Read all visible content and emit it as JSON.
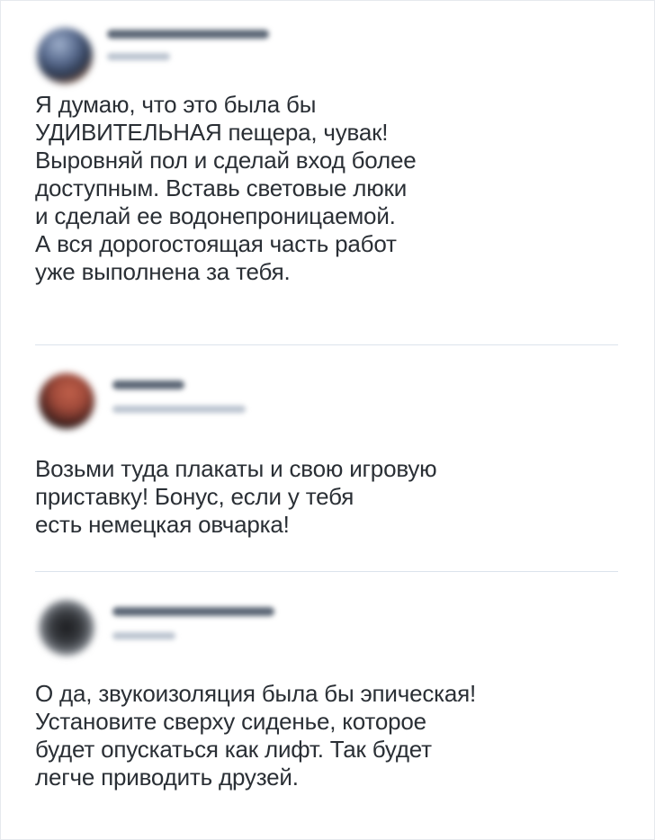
{
  "comments": [
    {
      "author": "",
      "time": "",
      "text": "Я думаю, что это была бы\nУДИВИТЕЛЬНАЯ пещера, чувак!\nВыровняй пол и сделай вход более\nдоступным. Вставь световые люки\nи сделай ее водонепроницаемой.\nА вся дорогостоящая часть работ\nуже выполнена за тебя.",
      "avatar_colors": [
        "#7b8aa8",
        "#2d3a52",
        "#8a5a3c"
      ]
    },
    {
      "author": "",
      "time": "",
      "text": "Возьми туда плакаты и свою игровую\nприставку! Бонус, если у тебя\nесть немецкая овчарка!",
      "avatar_colors": [
        "#a04a3a",
        "#5a2a24",
        "#1e1a1a"
      ]
    },
    {
      "author": "",
      "time": "",
      "text": "О да, звукоизоляция была бы эпическая!\nУстановите сверху сиденье, которое\nбудет опускаться как лифт. Так будет\nлегче приводить друзей.",
      "avatar_colors": [
        "#8a8f96",
        "#3a3d42",
        "#1b1c1f"
      ]
    }
  ]
}
